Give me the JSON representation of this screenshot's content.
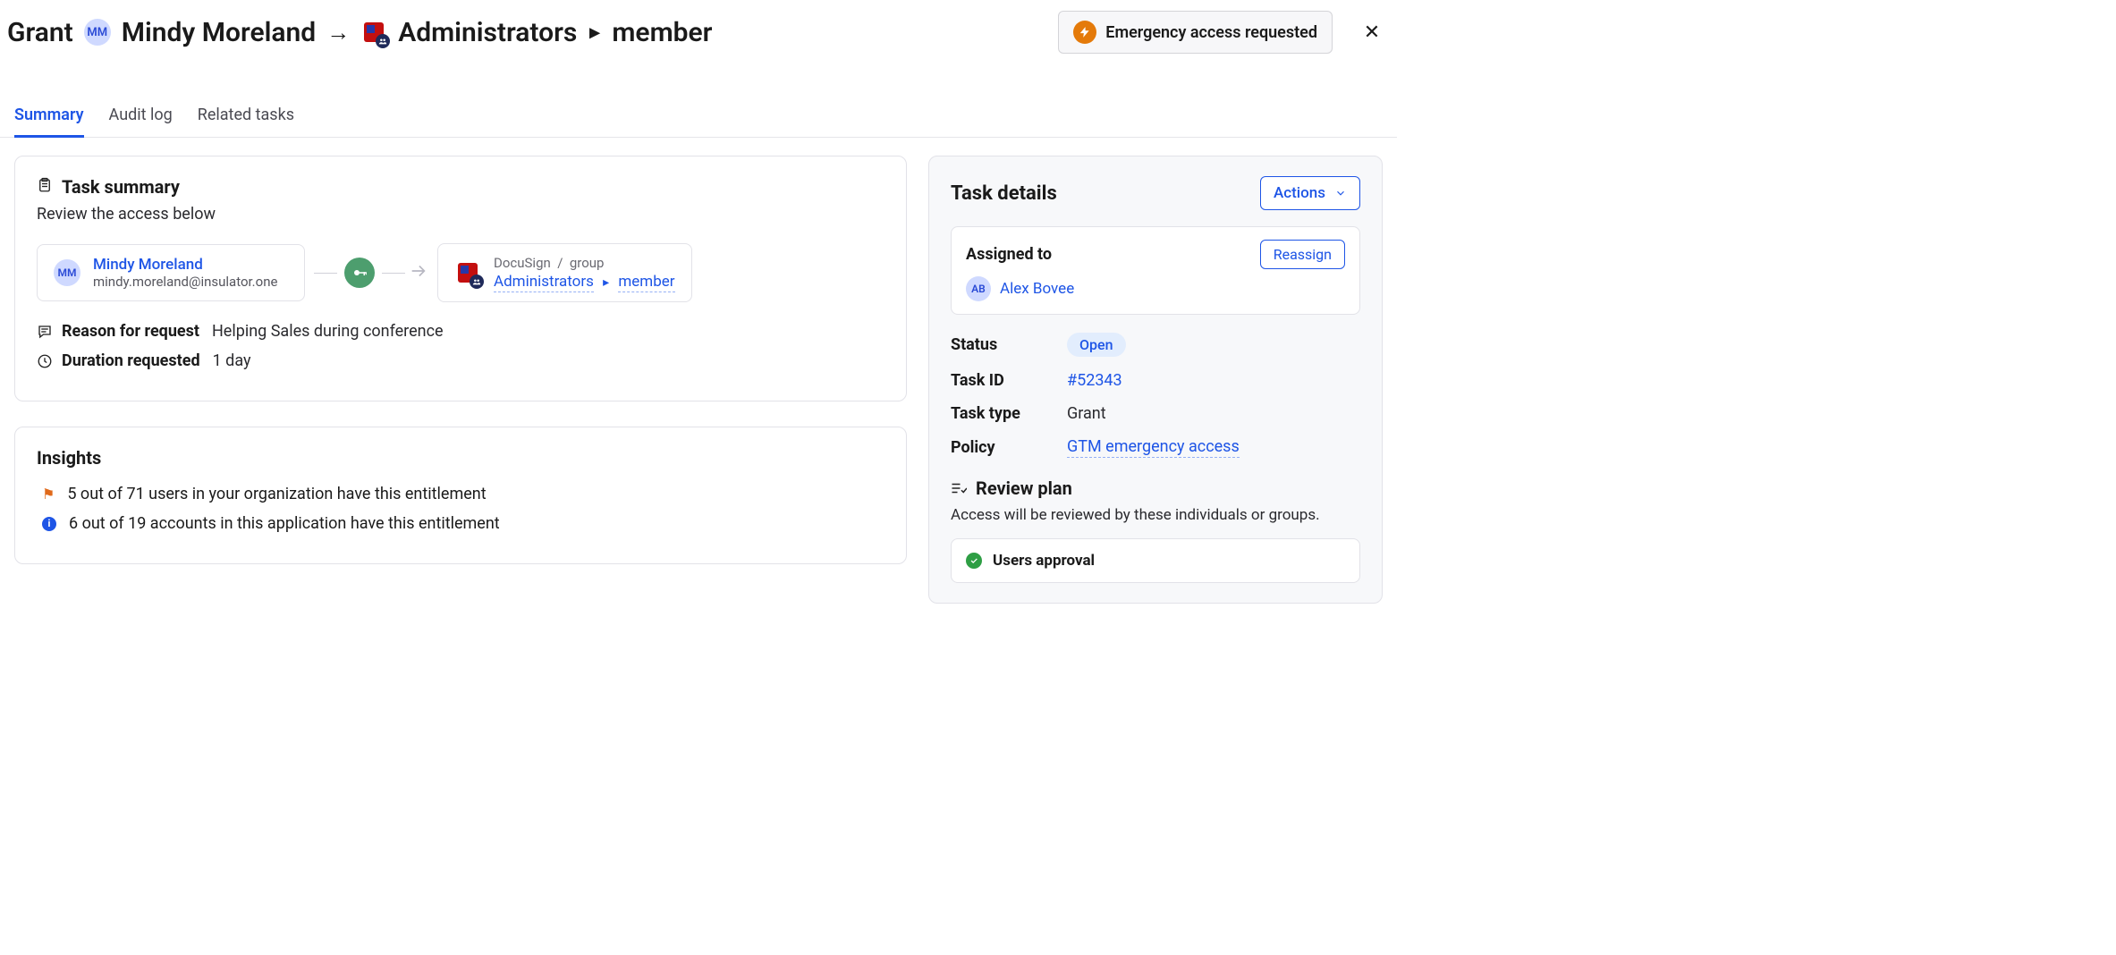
{
  "header": {
    "action": "Grant",
    "user_initials": "MM",
    "user_name": "Mindy Moreland",
    "target_group": "Administrators",
    "target_role": "member",
    "emergency_label": "Emergency access requested"
  },
  "tabs": [
    {
      "label": "Summary",
      "active": true
    },
    {
      "label": "Audit log",
      "active": false
    },
    {
      "label": "Related tasks",
      "active": false
    }
  ],
  "task_summary": {
    "title": "Task summary",
    "subtitle": "Review the access below",
    "user": {
      "initials": "MM",
      "name": "Mindy Moreland",
      "email": "mindy.moreland@insulator.one"
    },
    "entitlement": {
      "app": "DocuSign",
      "kind": "group",
      "group": "Administrators",
      "role": "member"
    },
    "reason_label": "Reason for request",
    "reason_value": "Helping Sales during conference",
    "duration_label": "Duration requested",
    "duration_value": "1 day"
  },
  "insights": {
    "title": "Insights",
    "items": [
      {
        "icon": "flag",
        "text": "5 out of 71 users in your organization have this entitlement"
      },
      {
        "icon": "info",
        "text": "6 out of 19 accounts in this application have this entitlement"
      }
    ]
  },
  "task_details": {
    "title": "Task details",
    "actions_label": "Actions",
    "assigned_to_label": "Assigned to",
    "reassign_label": "Reassign",
    "assignee": {
      "initials": "AB",
      "name": "Alex Bovee"
    },
    "rows": {
      "status_label": "Status",
      "status_value": "Open",
      "taskid_label": "Task ID",
      "taskid_value": "#52343",
      "tasktype_label": "Task type",
      "tasktype_value": "Grant",
      "policy_label": "Policy",
      "policy_value": "GTM emergency access"
    },
    "review": {
      "title": "Review plan",
      "subtitle": "Access will be reviewed by these individuals or groups.",
      "step_label": "Users approval"
    }
  }
}
